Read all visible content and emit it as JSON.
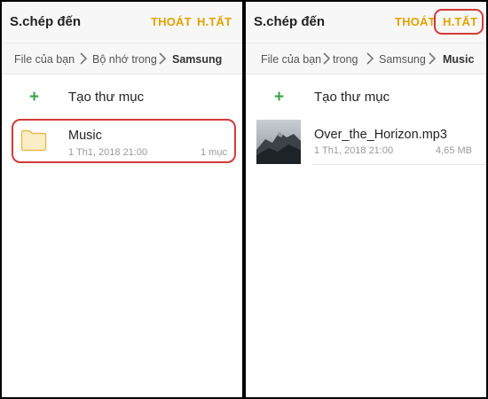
{
  "left": {
    "title": "S.chép đến",
    "actions": {
      "exit": "THOÁT",
      "done": "H.TẤT"
    },
    "breadcrumb": [
      "File của bạn",
      "Bộ nhớ trong",
      "Samsung"
    ],
    "create_folder": "Tạo thư mục",
    "items": [
      {
        "name": "Music",
        "date": "1 Th1, 2018 21:00",
        "count": "1 mục"
      }
    ]
  },
  "right": {
    "title": "S.chép đến",
    "actions": {
      "exit": "THOÁT",
      "done": "H.TẤT"
    },
    "breadcrumb": [
      "File của bạn",
      "trong",
      "Samsung",
      "Music"
    ],
    "create_folder": "Tạo thư mục",
    "items": [
      {
        "name": "Over_the_Horizon.mp3",
        "date": "1 Th1, 2018 21:00",
        "size": "4,65 MB"
      }
    ]
  },
  "colors": {
    "accent": "#e0a200",
    "highlight": "#d23a3a",
    "plus": "#3aa34a",
    "folder": "#f5d27a"
  },
  "icons": [
    "plus-icon",
    "folder-icon",
    "chevron-right-icon",
    "album-art-thumbnail"
  ]
}
